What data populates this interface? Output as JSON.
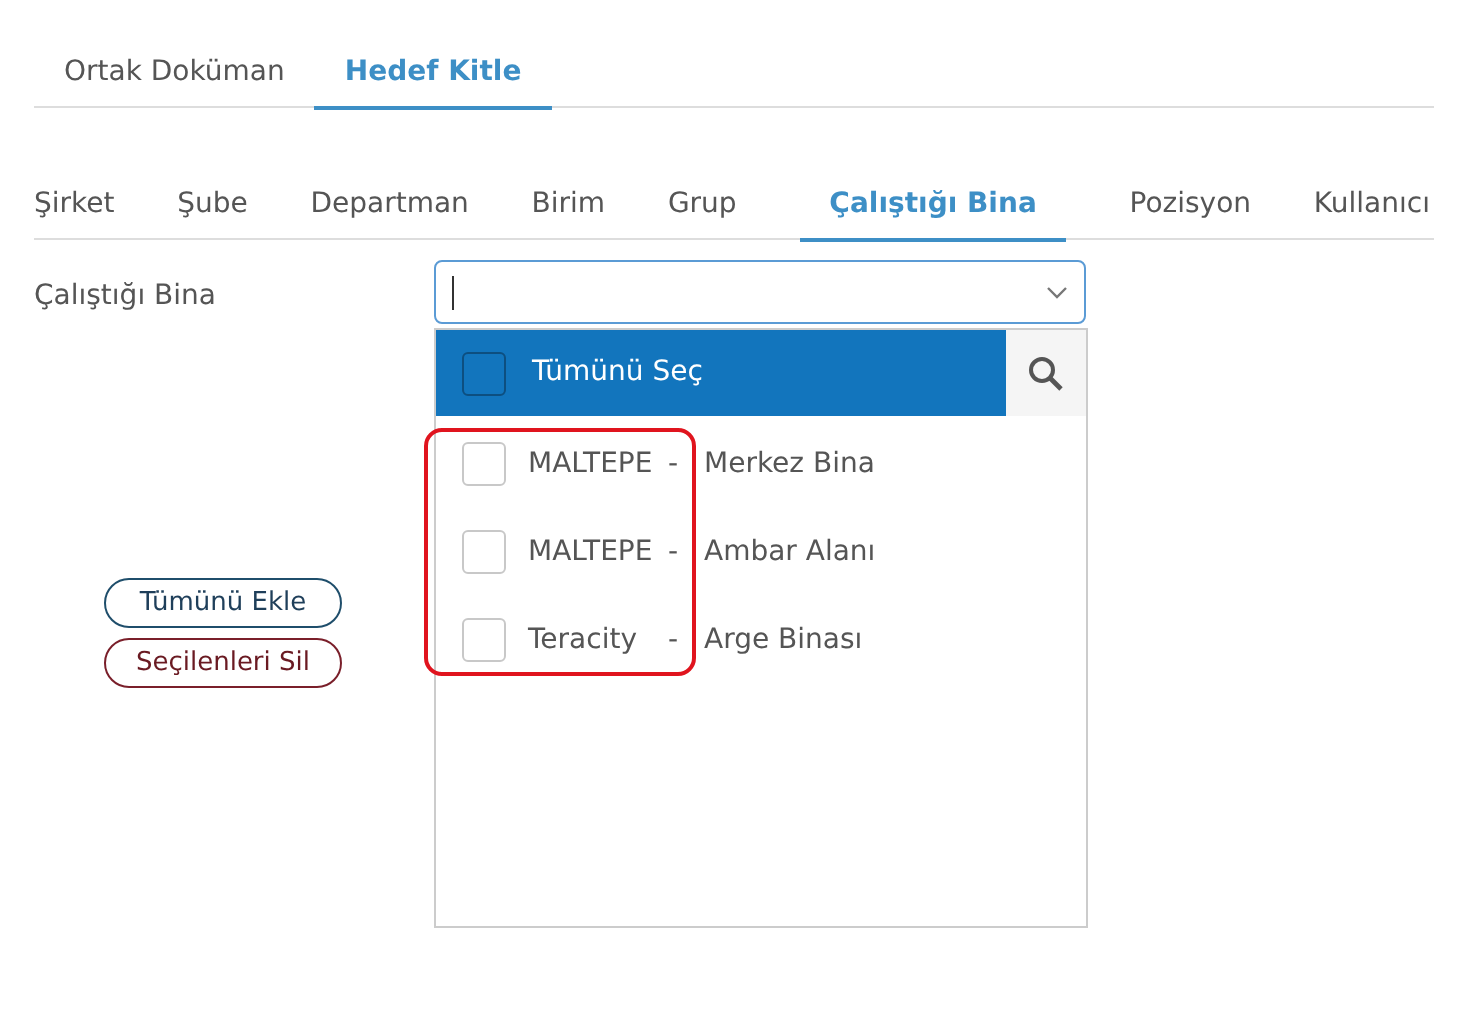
{
  "tabs": [
    {
      "label": "Ortak Doküman",
      "selected": false
    },
    {
      "label": "Hedef Kitle",
      "selected": true
    }
  ],
  "sub_tabs": [
    {
      "label": "Şirket",
      "selected": false
    },
    {
      "label": "Şube",
      "selected": false
    },
    {
      "label": "Departman",
      "selected": false
    },
    {
      "label": "Birim",
      "selected": false
    },
    {
      "label": "Grup",
      "selected": false
    },
    {
      "label": "Çalıştığı Bina",
      "selected": true
    },
    {
      "label": "Pozisyon",
      "selected": false
    },
    {
      "label": "Kullanıcı",
      "selected": false
    }
  ],
  "field": {
    "label": "Çalıştığı Bina"
  },
  "dropdown": {
    "select_all": {
      "label": "Tümünü Seç",
      "checked": false
    },
    "items": [
      {
        "code": "MALTEPE",
        "separator": "-",
        "name": "Merkez Bina",
        "checked": false
      },
      {
        "code": "MALTEPE",
        "separator": "-",
        "name": "Ambar Alanı",
        "checked": false
      },
      {
        "code": "Teracity",
        "separator": "-",
        "name": "Arge Binası",
        "checked": false
      }
    ]
  },
  "buttons": [
    {
      "label": "Tümünü Ekle",
      "kind": "add"
    },
    {
      "label": "Seçilenleri Sil",
      "kind": "remove"
    }
  ]
}
